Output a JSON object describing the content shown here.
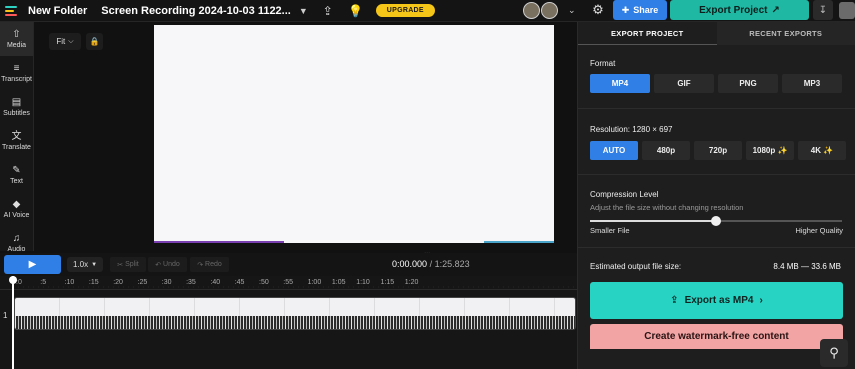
{
  "topbar": {
    "folder_name": "New Folder",
    "project_name": "Screen Recording 2024-10-03 1122...",
    "upgrade_label": "UPGRADE",
    "share_label": "Share",
    "export_project_label": "Export Project",
    "logo_colors": [
      "#2fd3c3",
      "#f5c518",
      "#ff5a5a",
      "#2f7fe6"
    ]
  },
  "nav": {
    "items": [
      {
        "label": "Media",
        "icon": "cloud-upload-icon"
      },
      {
        "label": "Transcript",
        "icon": "transcript-icon"
      },
      {
        "label": "Subtitles",
        "icon": "subtitles-icon"
      },
      {
        "label": "Translate",
        "icon": "translate-icon"
      },
      {
        "label": "Text",
        "icon": "text-icon"
      },
      {
        "label": "AI Voice",
        "icon": "ai-voice-icon"
      },
      {
        "label": "Audio",
        "icon": "music-note-icon"
      }
    ]
  },
  "canvas": {
    "fit_label": "Fit"
  },
  "playback": {
    "speed": "1.0x",
    "split_label": "Split",
    "undo_label": "Undo",
    "redo_label": "Redo",
    "current_time": "0:00.000",
    "duration": "/ 1:25.823"
  },
  "timeline": {
    "ticks": [
      ":0",
      ":5",
      ":10",
      ":15",
      ":20",
      ":25",
      ":30",
      ":35",
      ":40",
      ":45",
      ":50",
      ":55",
      "1:00",
      "1:05",
      "1:10",
      "1:15",
      "1:20"
    ],
    "track_number": "1"
  },
  "panel": {
    "tab_export": "EXPORT PROJECT",
    "tab_recent": "RECENT EXPORTS",
    "format_label": "Format",
    "formats": [
      "MP4",
      "GIF",
      "PNG",
      "MP3"
    ],
    "selected_format": "MP4",
    "resolution_label": "Resolution: 1280 × 697",
    "resolutions": [
      "AUTO",
      "480p",
      "720p",
      "1080p ✨",
      "4K ✨"
    ],
    "selected_resolution": "AUTO",
    "compression_label": "Compression Level",
    "compression_sub": "Adjust the file size without changing resolution",
    "compression_value": 0.5,
    "smaller_file_label": "Smaller File",
    "higher_quality_label": "Higher Quality",
    "estimated_label": "Estimated output file size:",
    "estimated_value": "8.4 MB — 33.6 MB",
    "export_button": "Export as MP4",
    "watermark_button": "Create watermark-free content"
  }
}
